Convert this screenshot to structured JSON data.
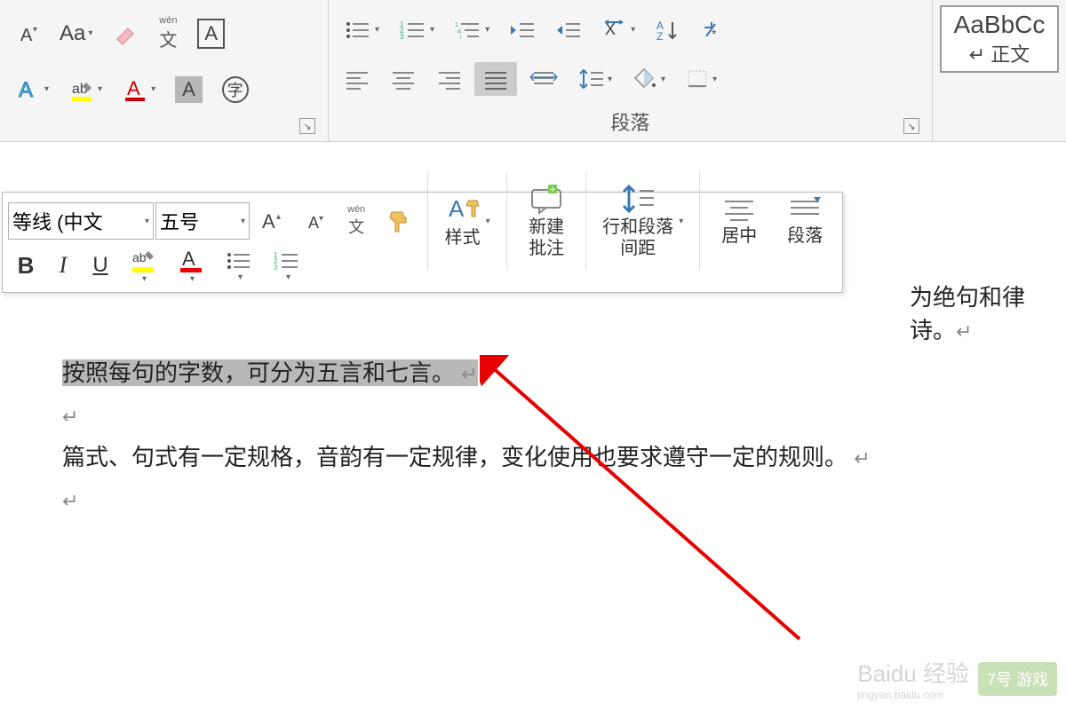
{
  "ribbon": {
    "paragraph_label": "段落",
    "style": {
      "sample": "AaBbCc",
      "name": "正文"
    }
  },
  "mini": {
    "font_name": "等线 (中文",
    "font_size": "五号",
    "phonetic_top": "wén",
    "phonetic_bottom": "文",
    "style_label": "样式",
    "comment_label_1": "新建",
    "comment_label_2": "批注",
    "spacing_label_1": "行和段落",
    "spacing_label_2": "间距",
    "center_label": "居中",
    "paragraph_label": "段落"
  },
  "document": {
    "partial_right": "为绝句和律诗。",
    "selected_line": "按照每句的字数，可分为五言和七言。",
    "line3": "篇式、句式有一定规格，音韵有一定规律，变化使用也要求遵守一定的规则。"
  },
  "watermark": {
    "brand": "Baidu 经验",
    "sub": "jingyan.baidu.com",
    "logo": "7号 游戏"
  }
}
